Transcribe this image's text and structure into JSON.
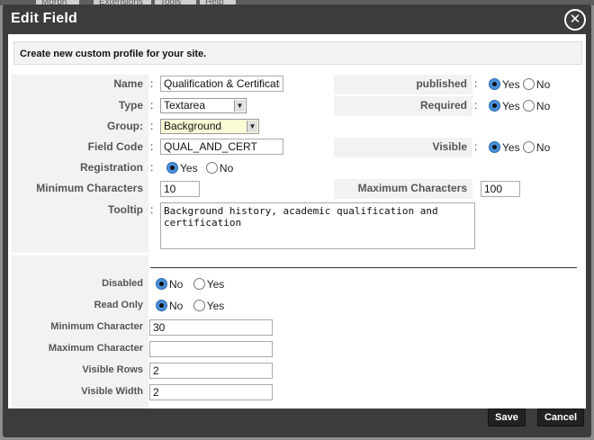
{
  "background": {
    "tabs": [
      "Morph",
      "Extensions",
      "Tools",
      "Help"
    ]
  },
  "modal": {
    "title": "Edit Field",
    "close_glyph": "✕",
    "notice": "Create new custom profile for your site.",
    "colon": ":",
    "fields": {
      "name": {
        "label": "Name",
        "value": "Qualification & Certification"
      },
      "type": {
        "label": "Type",
        "value": "Textarea"
      },
      "group": {
        "label": "Group:",
        "value": "Background"
      },
      "field_code": {
        "label": "Field Code",
        "value": "QUAL_AND_CERT"
      },
      "registration": {
        "label": "Registration",
        "yes": "Yes",
        "no": "No",
        "selected": "yes"
      },
      "min_chars": {
        "label": "Minimum Characters",
        "value": "10"
      },
      "max_chars": {
        "label": "Maximum Characters",
        "value": "100"
      },
      "tooltip": {
        "label": "Tooltip",
        "value": "Background history, academic qualification and certification"
      },
      "published": {
        "label": "published",
        "yes": "Yes",
        "no": "No",
        "selected": "yes"
      },
      "required": {
        "label": "Required",
        "yes": "Yes",
        "no": "No",
        "selected": "yes"
      },
      "visible": {
        "label": "Visible",
        "yes": "Yes",
        "no": "No",
        "selected": "yes"
      }
    },
    "params": {
      "disabled": {
        "label": "Disabled",
        "no": "No",
        "yes": "Yes",
        "selected": "no"
      },
      "read_only": {
        "label": "Read Only",
        "no": "No",
        "yes": "Yes",
        "selected": "no"
      },
      "min_character": {
        "label": "Minimum Character",
        "value": "30"
      },
      "max_character": {
        "label": "Maximum Character",
        "value": ""
      },
      "visible_rows": {
        "label": "Visible Rows",
        "value": "2"
      },
      "visible_width": {
        "label": "Visible Width",
        "value": "2"
      }
    },
    "buttons": {
      "save": "Save",
      "cancel": "Cancel"
    }
  },
  "colors": {
    "modal_bg": "#3c3c3c",
    "label_bg": "#f2f2f2",
    "radio_on": "#4a90d9"
  }
}
